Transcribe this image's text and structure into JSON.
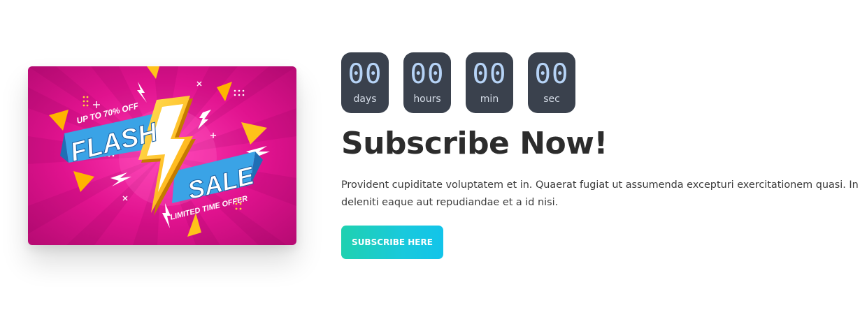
{
  "banner": {
    "top_text": "UP TO 70% OFF",
    "word1": "FLASH",
    "word2": "SALE",
    "bottom_text": "LIMITED TIME OFFER",
    "colors": {
      "background": "#e0128e",
      "ribbon": "#3aa3e6",
      "bolt": "#ffc21a"
    }
  },
  "countdown": [
    {
      "value": "00",
      "label": "days"
    },
    {
      "value": "00",
      "label": "hours"
    },
    {
      "value": "00",
      "label": "min"
    },
    {
      "value": "00",
      "label": "sec"
    }
  ],
  "heading": "Subscribe Now!",
  "description": "Provident cupiditate voluptatem et in. Quaerat fugiat ut assumenda excepturi exercitationem quasi. In deleniti eaque aut repudiandae et a id nisi.",
  "cta": {
    "label": "SUBSCRIBE HERE",
    "gradient": [
      "#1fd1b0",
      "#12c4ea"
    ]
  }
}
